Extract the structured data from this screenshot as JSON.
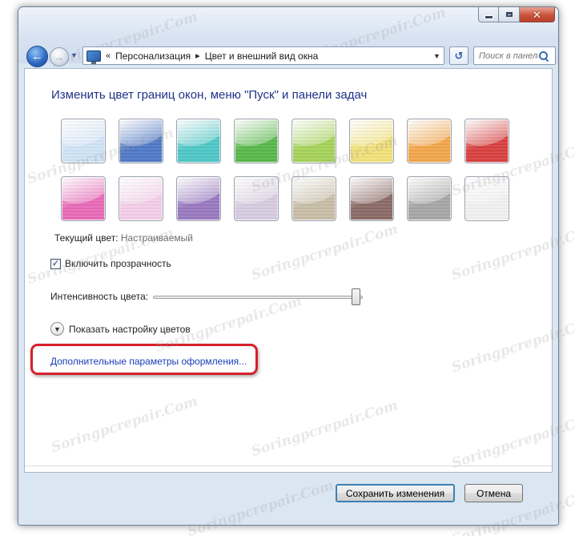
{
  "window": {
    "caption": {
      "minimize": "minimize",
      "maximize": "maximize",
      "close": "✕"
    }
  },
  "nav": {
    "back_icon": "back-arrow-icon",
    "forward_icon": "forward-arrow-icon",
    "address_prefix": "«",
    "breadcrumbs": [
      "Персонализация",
      "Цвет и внешний вид окна"
    ],
    "crumb_separator": "▸",
    "search_placeholder": "Поиск в панели ..."
  },
  "main": {
    "heading": "Изменить цвет границ окон, меню \"Пуск\" и панели задач",
    "swatches": [
      {
        "name": "sky",
        "color": "#cfe4f7"
      },
      {
        "name": "twilight",
        "color": "#4f79c7"
      },
      {
        "name": "sea",
        "color": "#4fc7c7"
      },
      {
        "name": "leaf",
        "color": "#58b84a"
      },
      {
        "name": "lime",
        "color": "#a6d35a"
      },
      {
        "name": "lemon",
        "color": "#f2e27a"
      },
      {
        "name": "orange",
        "color": "#f2a64a"
      },
      {
        "name": "ruby",
        "color": "#d8403f"
      },
      {
        "name": "fuchsia",
        "color": "#e86ab8"
      },
      {
        "name": "blush",
        "color": "#f4cde8"
      },
      {
        "name": "violet",
        "color": "#9a79c0"
      },
      {
        "name": "lavender",
        "color": "#d8cbe0"
      },
      {
        "name": "taupe",
        "color": "#c8bea6"
      },
      {
        "name": "chocolate",
        "color": "#8a6a66"
      },
      {
        "name": "slate",
        "color": "#a6a6a6"
      },
      {
        "name": "frost",
        "color": "#f1f1f1"
      }
    ],
    "current_color_label": "Текущий цвет:",
    "current_color_value": "Настраиваемый",
    "transparency_checked": true,
    "transparency_label": "Включить прозрачность",
    "intensity_label": "Интенсивность цвета:",
    "intensity_value": 1.0,
    "show_mixer_label": "Показать настройку цветов",
    "advanced_link": "Дополнительные параметры оформления..."
  },
  "footer": {
    "save_label": "Сохранить изменения",
    "cancel_label": "Отмена"
  },
  "watermark": "Soringpcrepair.Com"
}
